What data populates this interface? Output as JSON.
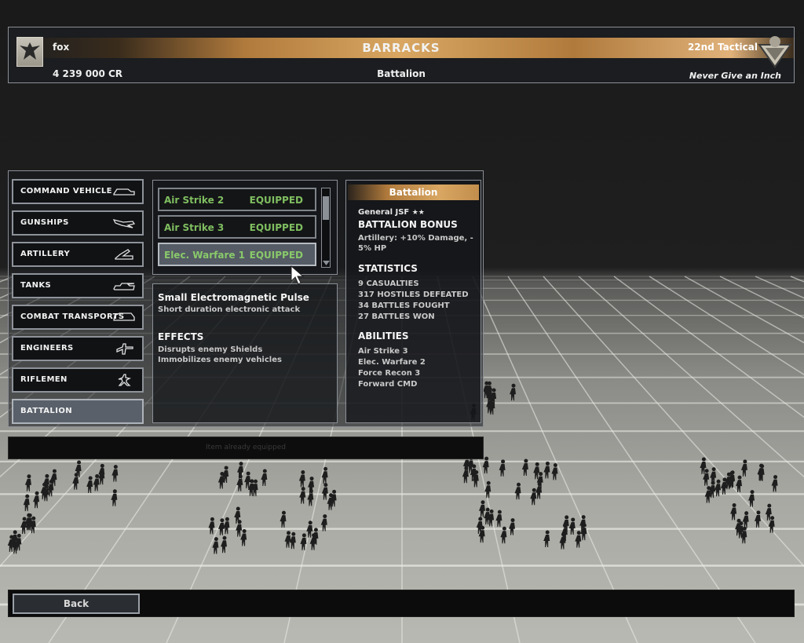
{
  "header": {
    "player_name": "fox",
    "credits": "4 239 000 CR",
    "title": "BARRACKS",
    "subtitle": "Battalion",
    "faction_name": "22nd Tactical",
    "faction_motto": "Never Give an Inch"
  },
  "categories": [
    {
      "label": "COMMAND VEHICLE",
      "icon": "command-vehicle-icon"
    },
    {
      "label": "GUNSHIPS",
      "icon": "gunship-icon"
    },
    {
      "label": "ARTILLERY",
      "icon": "artillery-icon"
    },
    {
      "label": "TANKS",
      "icon": "tank-icon"
    },
    {
      "label": "COMBAT TRANSPORTS",
      "icon": "transport-icon"
    },
    {
      "label": "ENGINEERS",
      "icon": "engineer-icon"
    },
    {
      "label": "RIFLEMEN",
      "icon": "rifleman-icon"
    },
    {
      "label": "BATTALION",
      "icon": ""
    }
  ],
  "active_category": "BATTALION",
  "equipment": [
    {
      "name": "Air Strike 2",
      "state": "EQUIPPED"
    },
    {
      "name": "Air Strike 3",
      "state": "EQUIPPED"
    },
    {
      "name": "Elec. Warfare 1",
      "state": "EQUIPPED"
    }
  ],
  "description": {
    "title": "Small Electromagnetic Pulse",
    "subtitle": "Short duration electronic attack",
    "effects_title": "EFFECTS",
    "effects": [
      "Disrupts enemy Shields",
      "Immobilizes enemy vehicles"
    ]
  },
  "info": {
    "heading": "Battalion",
    "general": "General JSF",
    "general_rank_stars": "★★",
    "bonus_title": "BATTALION BONUS",
    "bonus_lines": [
      "Artillery: +10% Damage, -",
      "5% HP"
    ],
    "stats_title": "STATISTICS",
    "stats": [
      "9 CASUALTIES",
      "317 HOSTILES DEFEATED",
      "34 BATTLES FOUGHT",
      "27 BATTLES WON"
    ],
    "abilities_title": "ABILITIES",
    "abilities": [
      "Air Strike 3",
      "Elec. Warfare 2",
      "Force Recon 3",
      "Forward CMD"
    ]
  },
  "status_message": "Item already equipped",
  "footer": {
    "back_label": "Back"
  },
  "colors": {
    "accent": "#d9a762",
    "equipped_text": "#7fbe60",
    "panel_border": "#8a8f96"
  }
}
